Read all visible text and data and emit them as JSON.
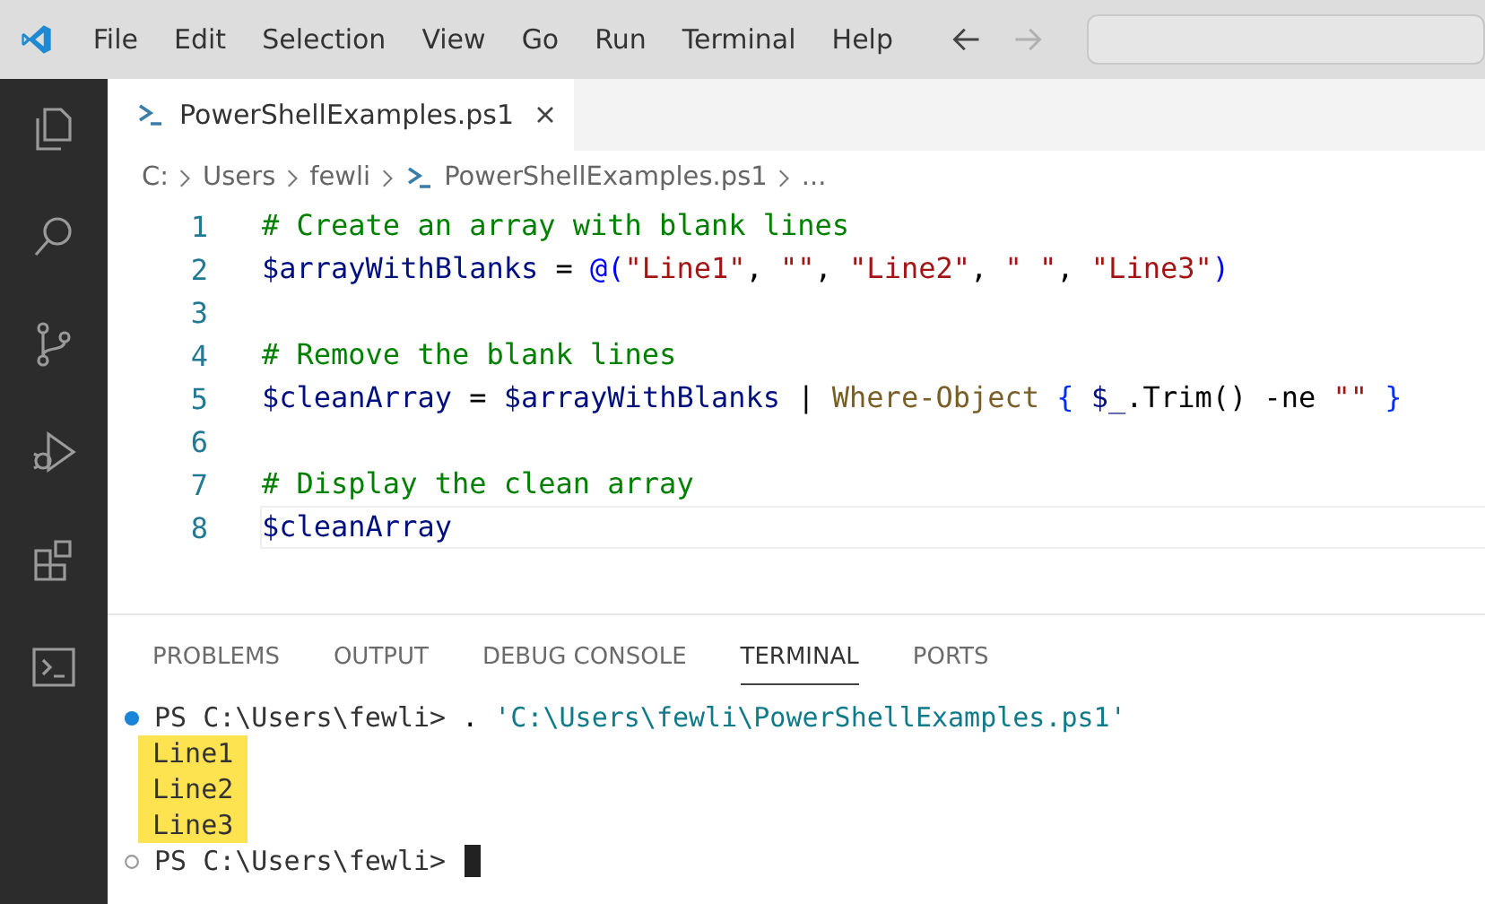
{
  "menu_bar": {
    "items": [
      "File",
      "Edit",
      "Selection",
      "View",
      "Go",
      "Run",
      "Terminal",
      "Help"
    ],
    "nav": [
      {
        "kind": "back",
        "disabled": false
      },
      {
        "kind": "forward",
        "disabled": true
      }
    ]
  },
  "activity_bar": [
    {
      "kind": "files",
      "selected": false
    },
    {
      "kind": "search",
      "selected": false
    },
    {
      "kind": "source-control",
      "selected": false
    },
    {
      "kind": "debug",
      "selected": false
    },
    {
      "kind": "extensions",
      "selected": false
    },
    {
      "kind": "terminal",
      "selected": false
    }
  ],
  "tabs": [
    {
      "label": "PowerShellExamples.ps1",
      "selected": true
    }
  ],
  "breadcrumb": [
    {
      "text": "C:",
      "kind": "folder"
    },
    {
      "text": "Users",
      "kind": "folder"
    },
    {
      "text": "fewli",
      "kind": "folder"
    },
    {
      "text": "PowerShellExamples.ps1",
      "kind": "file"
    },
    {
      "text": "...",
      "kind": "more"
    }
  ],
  "editor": {
    "lines": [
      {
        "number": "1",
        "current": false,
        "tokens": [
          {
            "text": "# Create an array with blank lines",
            "kind": "comment"
          }
        ]
      },
      {
        "number": "2",
        "current": false,
        "tokens": [
          {
            "text": "$arrayWithBlanks",
            "kind": "variable"
          },
          {
            "text": " = ",
            "kind": "plain"
          },
          {
            "text": "@(",
            "kind": "keyword"
          },
          {
            "text": "\"Line1\"",
            "kind": "string"
          },
          {
            "text": ",",
            "kind": "plain"
          },
          {
            "text": " \"\"",
            "kind": "string"
          },
          {
            "text": ", ",
            "kind": "plain"
          },
          {
            "text": "\"Line2\"",
            "kind": "string"
          },
          {
            "text": ", ",
            "kind": "plain"
          },
          {
            "text": "\" \"",
            "kind": "string"
          },
          {
            "text": ", ",
            "kind": "plain"
          },
          {
            "text": "\"Line3\"",
            "kind": "string"
          },
          {
            "text": ")",
            "kind": "keyword"
          }
        ]
      },
      {
        "number": "3",
        "current": false
      },
      {
        "number": "4",
        "current": false,
        "tokens": [
          {
            "text": "# Remove the blank lines",
            "kind": "comment"
          }
        ]
      },
      {
        "number": "5",
        "current": false,
        "tokens": [
          {
            "text": "$cleanArray",
            "kind": "variable"
          },
          {
            "text": " = ",
            "kind": "plain"
          },
          {
            "text": "$arrayWithBlanks",
            "kind": "variable"
          },
          {
            "text": " | ",
            "kind": "plain"
          },
          {
            "text": "Where-Object",
            "kind": "command"
          },
          {
            "text": " {",
            "kind": "brace"
          },
          {
            "text": " $_",
            "kind": "variable"
          },
          {
            "text": ".Trim() -ne",
            "kind": "plain"
          },
          {
            "text": " \"\"",
            "kind": "string"
          },
          {
            "text": " }",
            "kind": "brace"
          }
        ]
      },
      {
        "number": "6",
        "current": false
      },
      {
        "number": "7",
        "current": false,
        "tokens": [
          {
            "text": "# Display the clean array",
            "kind": "comment"
          }
        ]
      },
      {
        "number": "8",
        "current": true,
        "tokens": [
          {
            "text": "$cleanArray",
            "kind": "variable"
          }
        ]
      }
    ]
  },
  "panel": {
    "tabs": [
      {
        "label": "PROBLEMS",
        "selected": false
      },
      {
        "label": "OUTPUT",
        "selected": false
      },
      {
        "label": "DEBUG CONSOLE",
        "selected": false
      },
      {
        "label": "TERMINAL",
        "selected": true
      },
      {
        "label": "PORTS",
        "selected": false
      }
    ],
    "terminal": [
      {
        "kind": "prompt",
        "success": true,
        "prompt": "PS C:\\Users\\fewli>",
        "cursor": false,
        "tokens": [
          {
            "text": ".",
            "kind": "plain"
          },
          {
            "text": "'C:\\Users\\fewli\\PowerShellExamples.ps1'",
            "kind": "path"
          }
        ]
      },
      {
        "kind": "output",
        "text": "Line1",
        "highlighted": true
      },
      {
        "kind": "output",
        "text": "Line2",
        "highlighted": true
      },
      {
        "kind": "output",
        "text": "Line3",
        "highlighted": true
      },
      {
        "kind": "prompt",
        "success": false,
        "prompt": "PS C:\\Users\\fewli>",
        "cursor": true
      }
    ]
  }
}
